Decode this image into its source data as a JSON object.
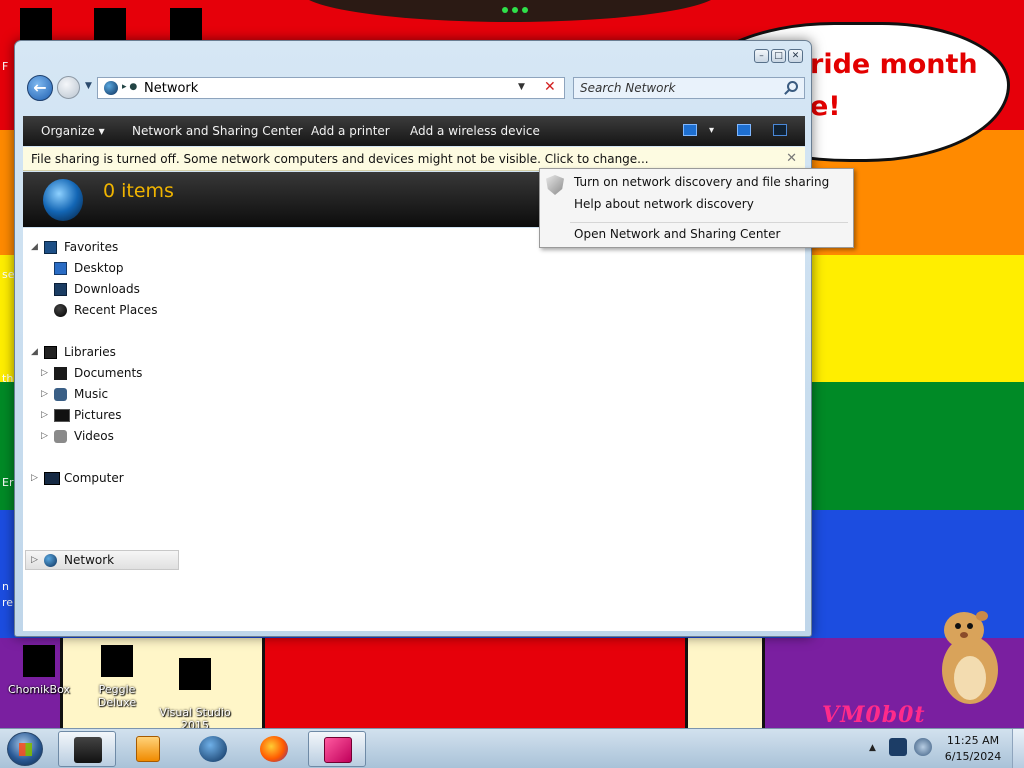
{
  "wallpaper": {
    "banner_text": "ride month\ne!",
    "watermark": "VM0b0t",
    "edge_labels": [
      "F",
      "se",
      "th",
      "Er",
      "n",
      "re"
    ]
  },
  "desktop_icons": [
    {
      "name": "chomikbox",
      "label": "ChomikBox"
    },
    {
      "name": "peggle-deluxe",
      "label": "Peggle Deluxe"
    },
    {
      "name": "visual-studio",
      "label": "Visual Studio\n2015"
    }
  ],
  "window": {
    "caption_buttons": {
      "minimize": "–",
      "maximize": "□",
      "close": "✕"
    },
    "address": {
      "location": "Network",
      "separator": "▸ ●",
      "dropdown": "▼",
      "clear": "✕"
    },
    "search": {
      "placeholder": "Search Network"
    },
    "toolbar": {
      "organize": "Organize ▾",
      "network_sharing_center": "Network and Sharing Center",
      "add_printer": "Add a printer",
      "add_wireless": "Add a wireless device",
      "view_dropdown": "▾"
    },
    "infobar": {
      "message": "File sharing is turned off. Some network computers and devices might not be visible. Click to change...",
      "close": "✕"
    },
    "header": {
      "items_count": "0 items"
    },
    "nav": {
      "favorites": {
        "label": "Favorites",
        "items": [
          "Desktop",
          "Downloads",
          "Recent Places"
        ]
      },
      "libraries": {
        "label": "Libraries",
        "items": [
          "Documents",
          "Music",
          "Pictures",
          "Videos"
        ]
      },
      "computer": "Computer",
      "network": "Network",
      "expanded_glyph": "◢",
      "collapsed_glyph": "▷"
    }
  },
  "context_menu": {
    "items": [
      "Turn on network discovery and file sharing",
      "Help about network discovery",
      "Open Network and Sharing Center"
    ]
  },
  "taskbar": {
    "tray_arrow": "▲",
    "time": "11:25 AM",
    "date": "6/15/2024"
  },
  "colors": {
    "accent_cmdbar": "#151515",
    "items_count": "#f0b400",
    "infobar_bg": "#fdfbe1",
    "banner_text": "#e30000"
  }
}
